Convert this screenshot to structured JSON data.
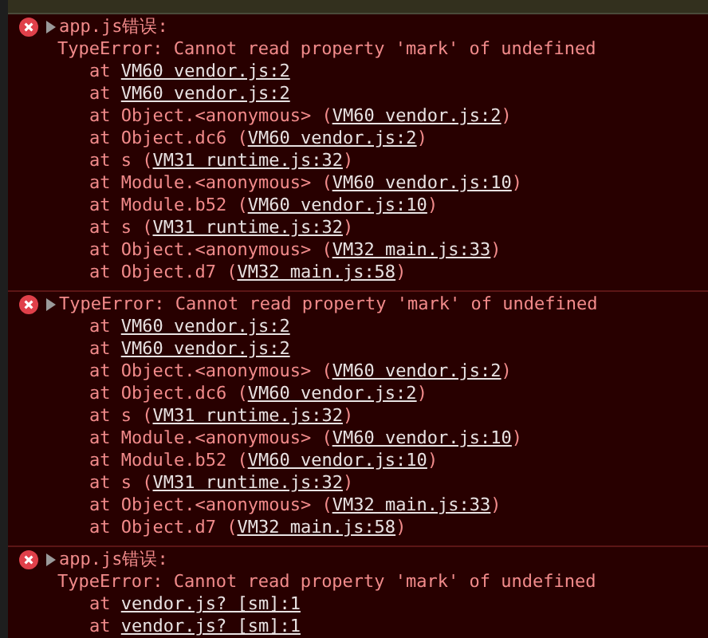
{
  "entries": [
    {
      "expanded": false,
      "header": "app.js错误:",
      "message": "TypeError: Cannot read property 'mark' of undefined",
      "frames": [
        {
          "before": "at ",
          "link": "VM60 vendor.js:2"
        },
        {
          "before": "at ",
          "link": "VM60 vendor.js:2"
        },
        {
          "before": "at Object.<anonymous> (",
          "link": "VM60 vendor.js:2",
          "after": ")"
        },
        {
          "before": "at Object.dc6 (",
          "link": "VM60 vendor.js:2",
          "after": ")"
        },
        {
          "before": "at s (",
          "link": "VM31 runtime.js:32",
          "after": ")"
        },
        {
          "before": "at Module.<anonymous> (",
          "link": "VM60 vendor.js:10",
          "after": ")"
        },
        {
          "before": "at Module.b52 (",
          "link": "VM60 vendor.js:10",
          "after": ")"
        },
        {
          "before": "at s (",
          "link": "VM31 runtime.js:32",
          "after": ")"
        },
        {
          "before": "at Object.<anonymous> (",
          "link": "VM32 main.js:33",
          "after": ")"
        },
        {
          "before": "at Object.d7 (",
          "link": "VM32 main.js:58",
          "after": ")"
        }
      ]
    },
    {
      "expanded": false,
      "header": "TypeError: Cannot read property 'mark' of undefined",
      "frames": [
        {
          "before": "at ",
          "link": "VM60 vendor.js:2"
        },
        {
          "before": "at ",
          "link": "VM60 vendor.js:2"
        },
        {
          "before": "at Object.<anonymous> (",
          "link": "VM60 vendor.js:2",
          "after": ")"
        },
        {
          "before": "at Object.dc6 (",
          "link": "VM60 vendor.js:2",
          "after": ")"
        },
        {
          "before": "at s (",
          "link": "VM31 runtime.js:32",
          "after": ")"
        },
        {
          "before": "at Module.<anonymous> (",
          "link": "VM60 vendor.js:10",
          "after": ")"
        },
        {
          "before": "at Module.b52 (",
          "link": "VM60 vendor.js:10",
          "after": ")"
        },
        {
          "before": "at s (",
          "link": "VM31 runtime.js:32",
          "after": ")"
        },
        {
          "before": "at Object.<anonymous> (",
          "link": "VM32 main.js:33",
          "after": ")"
        },
        {
          "before": "at Object.d7 (",
          "link": "VM32 main.js:58",
          "after": ")"
        }
      ]
    },
    {
      "expanded": false,
      "header": "app.js错误:",
      "message": "TypeError: Cannot read property 'mark' of undefined",
      "frames": [
        {
          "before": "at ",
          "link": "vendor.js? [sm]:1"
        },
        {
          "before": "at ",
          "link": "vendor.js? [sm]:1"
        }
      ]
    }
  ]
}
